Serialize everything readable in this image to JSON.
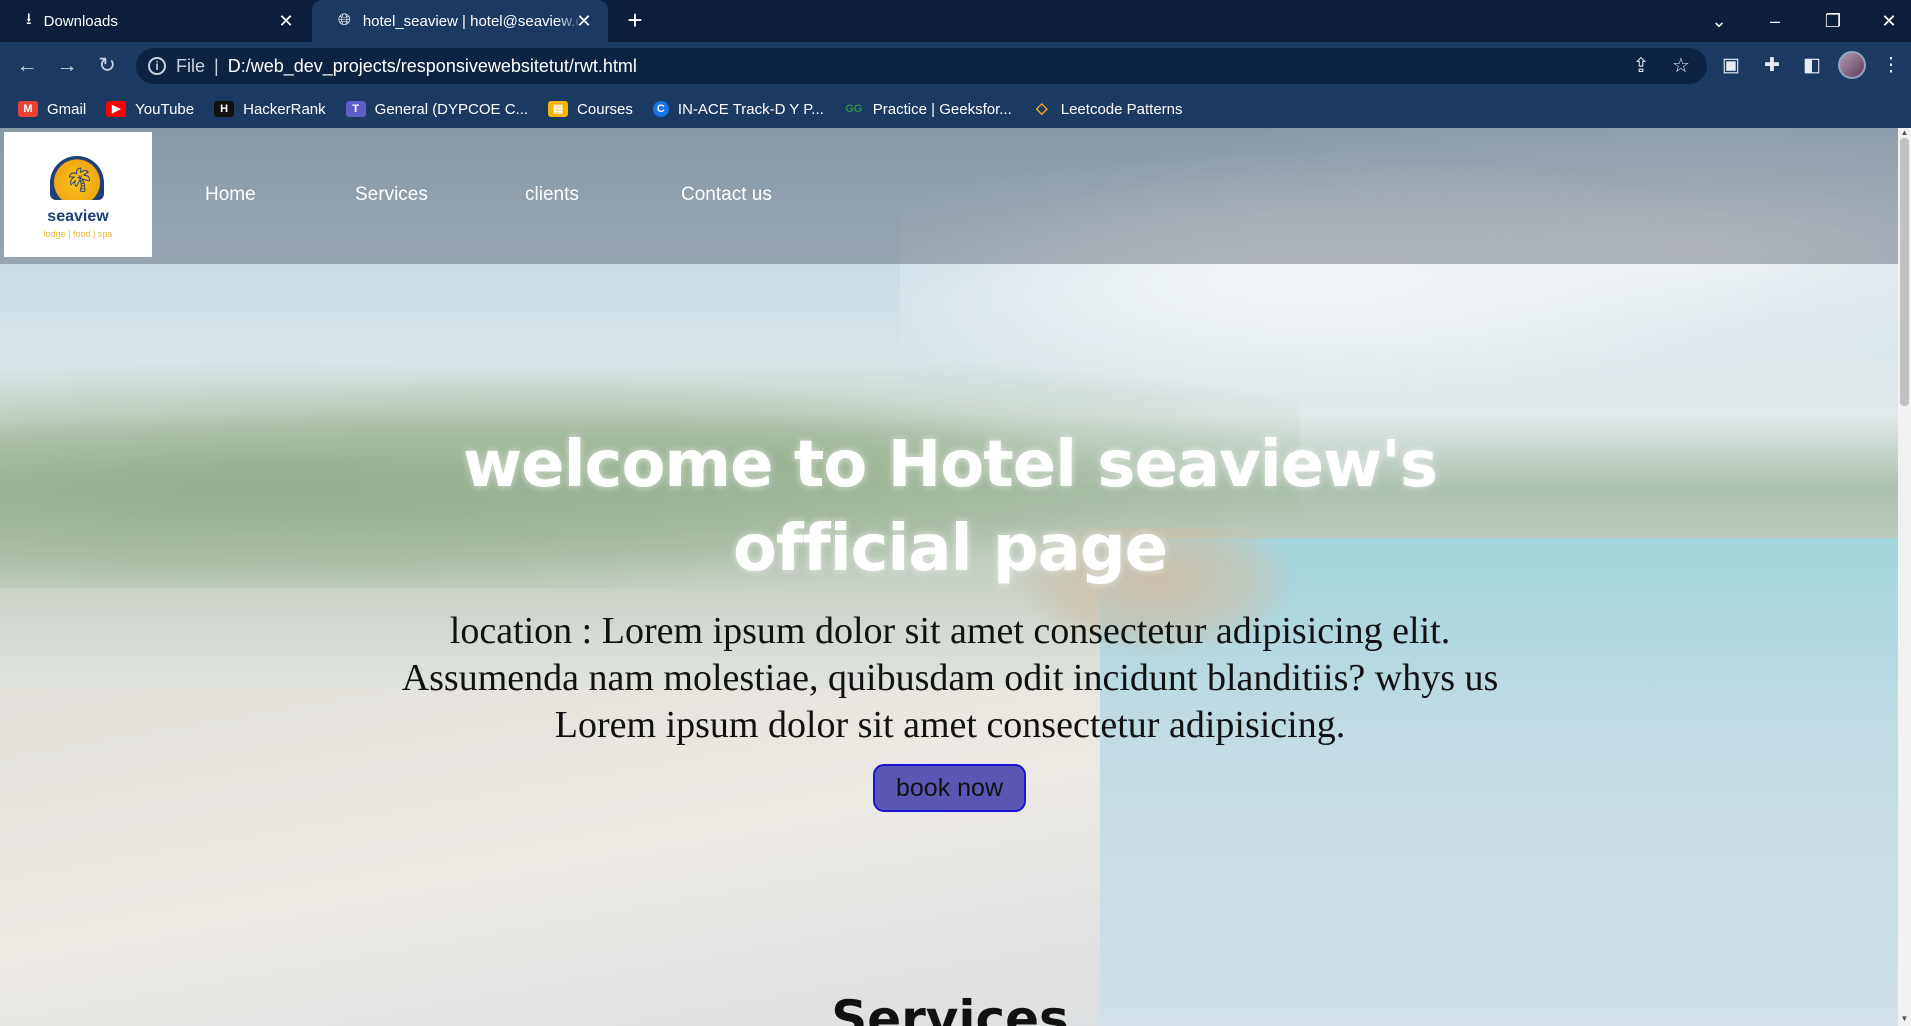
{
  "browser": {
    "tabs": [
      {
        "title": "Downloads",
        "icon": "download-icon",
        "active": false
      },
      {
        "title": "hotel_seaview | hotel@seaview.com",
        "icon": "globe-icon",
        "active": true
      }
    ],
    "address": {
      "scheme": "File",
      "url": "D:/web_dev_projects/responsivewebsitetut/rwt.html"
    },
    "bookmarks": [
      {
        "label": "Gmail",
        "icon": "gmail-icon",
        "color": "#ea4335"
      },
      {
        "label": "YouTube",
        "icon": "youtube-icon",
        "color": "#ff0000"
      },
      {
        "label": "HackerRank",
        "icon": "hackerrank-icon",
        "color": "#111111"
      },
      {
        "label": "General (DYPCOE C...",
        "icon": "teams-icon",
        "color": "#5b5fc7"
      },
      {
        "label": "Courses",
        "icon": "classroom-icon",
        "color": "#f4b400"
      },
      {
        "label": "IN-ACE Track-D Y P...",
        "icon": "c-icon",
        "color": "#1a73e8"
      },
      {
        "label": "Practice | Geeksfor...",
        "icon": "geeksforgeeks-icon",
        "color": "#2f8d46"
      },
      {
        "label": "Leetcode Patterns",
        "icon": "leetcode-icon",
        "color": "#f5a623"
      }
    ]
  },
  "site": {
    "logo": {
      "name": "seaview",
      "tagline": "lodge | food | spa"
    },
    "nav": [
      "Home",
      "Services",
      "clients",
      "Contact us"
    ],
    "hero": {
      "title": "welcome to Hotel seaview's official page",
      "text": "location : Lorem ipsum dolor sit amet consectetur adipisicing elit. Assumenda nam molestiae, quibusdam odit incidunt blanditiis? whys us Lorem ipsum dolor sit amet consectetur adipisicing.",
      "button": "book now"
    },
    "section_title": "Services"
  },
  "colors": {
    "chrome_dark": "#0b1f3d",
    "chrome": "#1b3a62",
    "button": "#5b56b4",
    "button_border": "#1c14d6"
  }
}
